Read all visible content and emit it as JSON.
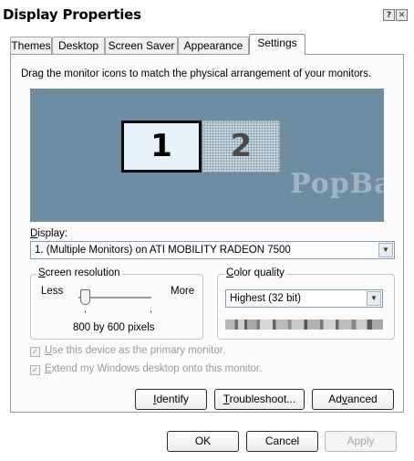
{
  "window": {
    "title": "Display Properties",
    "help_glyph": "?",
    "close_glyph": "✕"
  },
  "tabs": [
    "Themes",
    "Desktop",
    "Screen Saver",
    "Appearance",
    "Settings"
  ],
  "active_tab": "Settings",
  "instructions": "Drag the monitor icons to match the physical arrangement of your monitors.",
  "monitors": [
    {
      "label": "1",
      "state": "active"
    },
    {
      "label": "2",
      "state": "inactive"
    }
  ],
  "display": {
    "label_prefix": "D",
    "label_rest": "isplay:",
    "value": "1. (Multiple Monitors) on ATI MOBILITY RADEON 7500"
  },
  "screen_resolution": {
    "legend_prefix": "S",
    "legend_rest": "creen resolution",
    "less": "Less",
    "more": "More",
    "value_text": "800 by 600 pixels",
    "slider_position": 0
  },
  "color_quality": {
    "legend_prefix": "C",
    "legend_rest": "olor quality",
    "selected": "Highest (32 bit)"
  },
  "checkboxes": [
    {
      "u": "U",
      "rest": "se this device as the primary monitor.",
      "checked": true,
      "enabled": false
    },
    {
      "u": "E",
      "rest": "xtend my Windows desktop onto this monitor.",
      "checked": true,
      "enabled": false
    }
  ],
  "buttons": {
    "identify_u": "I",
    "identify_rest": "dentify",
    "troubleshoot_u": "T",
    "troubleshoot_rest": "roubleshoot...",
    "advanced_pre": "Ad",
    "advanced_u": "v",
    "advanced_rest": "anced"
  },
  "footer": {
    "ok": "OK",
    "cancel": "Cancel",
    "apply": "Apply"
  },
  "watermark": "PopBa"
}
